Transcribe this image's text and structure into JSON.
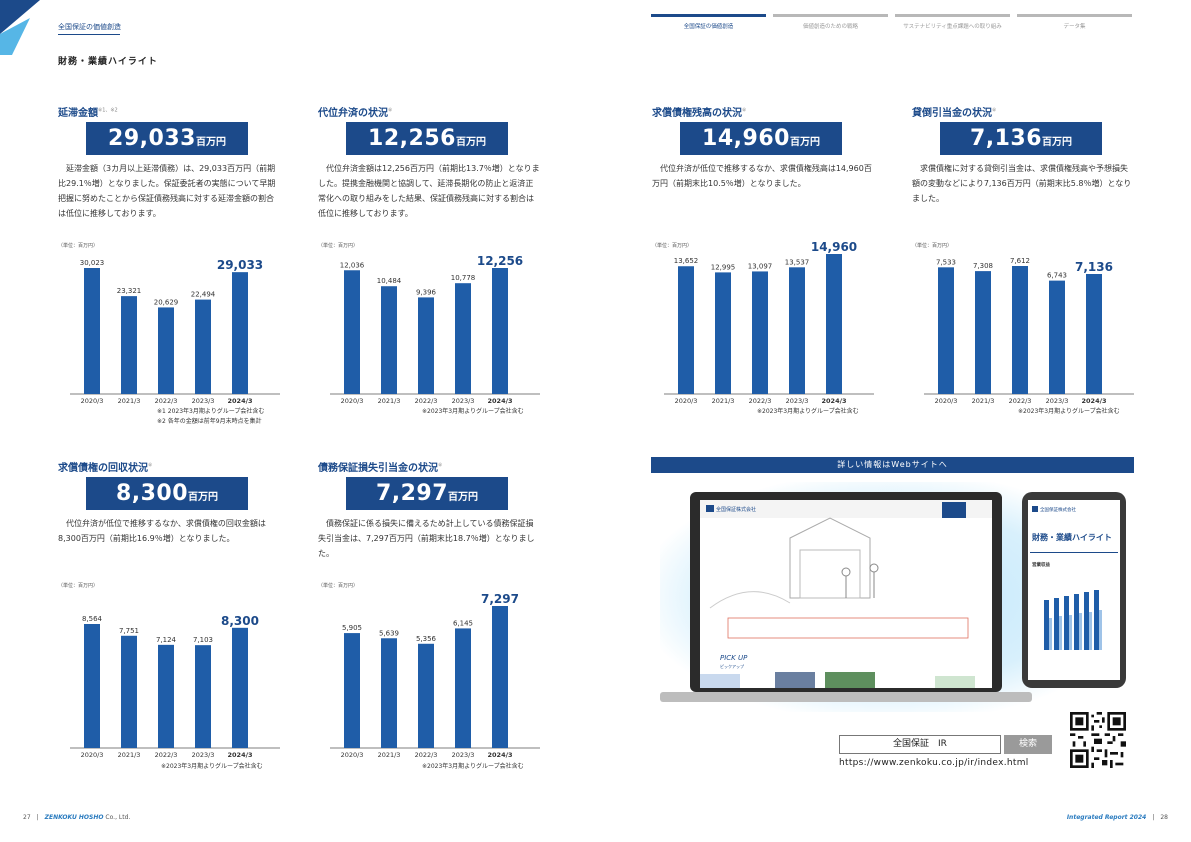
{
  "header": {
    "section_label": "全国保証の価値創造",
    "page_title": "財務・業績ハイライト",
    "tabs": [
      "全国保証の価値創造",
      "価値創造のための戦略",
      "サステナビリティ重点課題への取り組み",
      "データ集"
    ]
  },
  "colors": {
    "navy": "#1c4a8a",
    "bar": "#1f5da8",
    "accent": "#2a7bbf"
  },
  "panels": [
    {
      "title": "延滞金額",
      "sup": "※1、※2",
      "value": "29,033",
      "unit": "百万円",
      "desc": "延滞金額（3カ月以上延滞債務）は、29,033百万円（前期比29.1％増）となりました。保証委託者の実態について早期把握に努めたことから保証債務残高に対する延滞金額の割合は低位に推移しております。",
      "unit_label": "（単位：百万円）",
      "notes": [
        "※1 2023年3月期よりグループ会社含む",
        "※2 各年の金額は前年9月末時点を集計"
      ]
    },
    {
      "title": "代位弁済の状況",
      "sup": "※",
      "value": "12,256",
      "unit": "百万円",
      "desc": "代位弁済金額は12,256百万円（前期比13.7％増）となりました。提携金融機関と協調して、延滞長期化の防止と返済正常化への取り組みをした結果、保証債務残高に対する割合は低位に推移しております。",
      "unit_label": "（単位：百万円）",
      "notes": [
        "※2023年3月期よりグループ会社含む"
      ]
    },
    {
      "title": "求償債権残高の状況",
      "sup": "※",
      "value": "14,960",
      "unit": "百万円",
      "desc": "代位弁済が低位で推移するなか、求償債権残高は14,960百万円（前期末比10.5％増）となりました。",
      "unit_label": "（単位：百万円）",
      "notes": [
        "※2023年3月期よりグループ会社含む"
      ]
    },
    {
      "title": "貸倒引当金の状況",
      "sup": "※",
      "value": "7,136",
      "unit": "百万円",
      "desc": "求償債権に対する貸倒引当金は、求償債権残高や予想損失額の変動などにより7,136百万円（前期末比5.8％増）となりました。",
      "unit_label": "（単位：百万円）",
      "notes": [
        "※2023年3月期よりグループ会社含む"
      ]
    },
    {
      "title": "求償債権の回収状況",
      "sup": "※",
      "value": "8,300",
      "unit": "百万円",
      "desc": "代位弁済が低位で推移するなか、求償債権の回収金額は8,300百万円（前期比16.9％増）となりました。",
      "unit_label": "（単位：百万円）",
      "notes": [
        "※2023年3月期よりグループ会社含む"
      ]
    },
    {
      "title": "債務保証損失引当金の状況",
      "sup": "※",
      "value": "7,297",
      "unit": "百万円",
      "desc": "債務保証に係る損失に備えるため計上している債務保証損失引当金は、7,297百万円（前期末比18.7％増）となりました。",
      "unit_label": "（単位：百万円）",
      "notes": [
        "※2023年3月期よりグループ会社含む"
      ]
    }
  ],
  "chart_data": [
    {
      "type": "bar",
      "categories": [
        "2020/3",
        "2021/3",
        "2022/3",
        "2023/3",
        "2024/3"
      ],
      "values": [
        30023,
        23321,
        20629,
        22494,
        29033
      ]
    },
    {
      "type": "bar",
      "categories": [
        "2020/3",
        "2021/3",
        "2022/3",
        "2023/3",
        "2024/3"
      ],
      "values": [
        12036,
        10484,
        9396,
        10778,
        12256
      ]
    },
    {
      "type": "bar",
      "categories": [
        "2020/3",
        "2021/3",
        "2022/3",
        "2023/3",
        "2024/3"
      ],
      "values": [
        13652,
        12995,
        13097,
        13537,
        14960
      ]
    },
    {
      "type": "bar",
      "categories": [
        "2020/3",
        "2021/3",
        "2022/3",
        "2023/3",
        "2024/3"
      ],
      "values": [
        7533,
        7308,
        7612,
        6743,
        7136
      ]
    },
    {
      "type": "bar",
      "categories": [
        "2020/3",
        "2021/3",
        "2022/3",
        "2023/3",
        "2024/3"
      ],
      "values": [
        8564,
        7751,
        7124,
        7103,
        8300
      ]
    },
    {
      "type": "bar",
      "categories": [
        "2020/3",
        "2021/3",
        "2022/3",
        "2023/3",
        "2024/3"
      ],
      "values": [
        5905,
        5639,
        5356,
        6145,
        7297
      ]
    }
  ],
  "web": {
    "banner": "詳しい情報はWebサイトへ",
    "search_text": "全国保証　IR",
    "search_button": "検索",
    "url": "https://www.zenkoku.co.jp/ir/index.html",
    "screen": {
      "company": "全国保証株式会社",
      "pickup": "PICK UP",
      "pickup_sub": "ピックアップ",
      "phone_title": "財務・業績ハイライト",
      "phone_sub": "営業収益"
    }
  },
  "footer": {
    "left_page": "27",
    "left_brand": "ZENKOKU HOSHO",
    "left_suffix": "Co., Ltd.",
    "right_brand": "Integrated Report 2024",
    "right_page": "28"
  }
}
